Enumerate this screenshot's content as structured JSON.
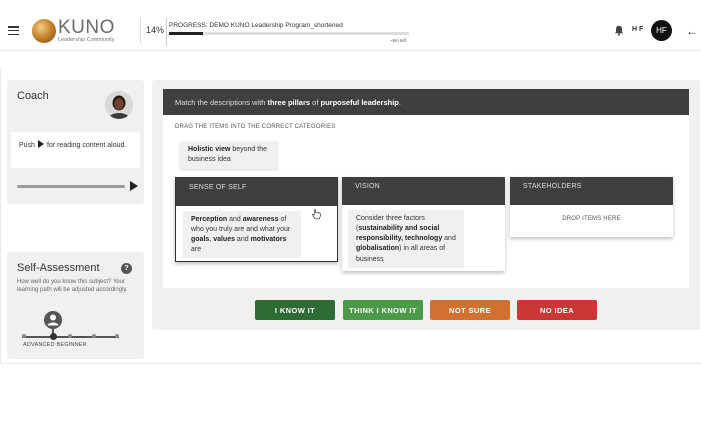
{
  "header": {
    "logo_name": "KUNO",
    "logo_sub": "Leadership Community",
    "percent": "14%",
    "progress_label": "PROGRESS: DEMO KUNO Leadership Program_shortened",
    "progress_fraction": 0.14,
    "time_left": "~9m left",
    "user_initials": "H F",
    "avatar_initials": "HF"
  },
  "coach": {
    "title": "Coach",
    "push_prefix": "Push",
    "push_suffix": "for reading content aloud."
  },
  "self_assessment": {
    "title": "Self-Assessment",
    "help": "?",
    "description": "How well do you know this subject? Your learning path will be adjusted accordingly.",
    "level_label": "ADVANCED BEGINNER"
  },
  "question": {
    "prefix": "Match the descriptions with ",
    "bold1": "three pillars",
    "middle": " of ",
    "bold2": "purposeful leadership",
    "suffix": ".",
    "instruction": "DRAG THE ITEMS INTO THE CORRECT CATEGORIES"
  },
  "unplaced_item": {
    "bold": "Holistic view",
    "rest": " beyond the business idea"
  },
  "categories": {
    "self": {
      "title": "SENSE OF SELF",
      "item": {
        "b1": "Perception",
        "t1": " and ",
        "b2": "awareness",
        "t2": " of who you truly are and what your ",
        "b3": "goals",
        "t3": ", ",
        "b4": "values",
        "t4": " and ",
        "b5": "motivators",
        "t5": " are"
      }
    },
    "vision": {
      "title": "VISION",
      "item": {
        "t1": "Consider three factors (",
        "b1": "sustainability and social responsibility, technology",
        "t2": " and ",
        "b2": "globalisation",
        "t3": ") in all areas of business"
      }
    },
    "stakeholders": {
      "title": "STAKEHOLDERS",
      "drop_text": "DROP ITEMS HERE"
    }
  },
  "answers": {
    "know": "I KNOW IT",
    "think": "THINK I KNOW IT",
    "not_sure": "NOT SURE",
    "no_idea": "NO IDEA"
  },
  "colors": {
    "dark_bar": "#3f3f3f",
    "know": "#2f6b34",
    "think": "#4c9a47",
    "not_sure": "#d27031",
    "no_idea": "#c93737"
  }
}
